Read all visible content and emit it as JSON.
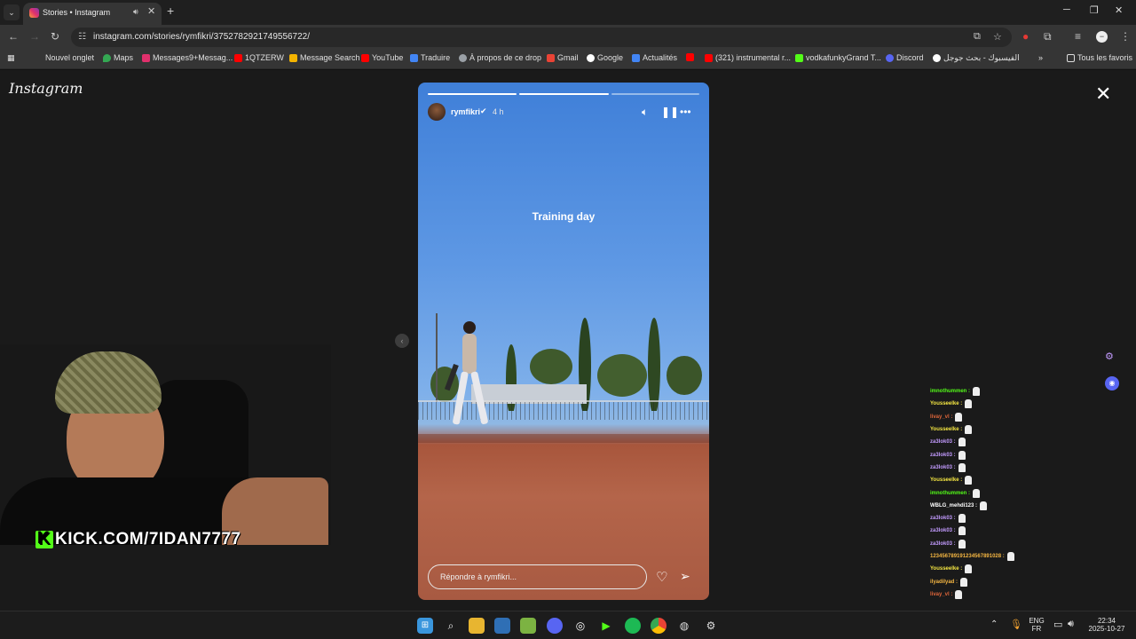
{
  "browser": {
    "tab_title": "Stories • Instagram",
    "url": "instagram.com/stories/rymfikri/3752782921749556722/",
    "bookmarks": [
      {
        "label": "Nouvel onglet",
        "color": "#9aa0a6"
      },
      {
        "label": "Maps",
        "color": "#34a853"
      },
      {
        "label": "Messages9+Messag...",
        "color": "#e1306c"
      },
      {
        "label": "1QTZERW",
        "color": "#ff0000"
      },
      {
        "label": "Message Search",
        "color": "#f4b400"
      },
      {
        "label": "YouTube",
        "color": "#ff0000"
      },
      {
        "label": "Traduire",
        "color": "#4285f4"
      },
      {
        "label": "À propos de ce drop",
        "color": "#9aa0a6"
      },
      {
        "label": "Gmail",
        "color": "#ea4335"
      },
      {
        "label": "Google",
        "color": "#9aa0a6"
      },
      {
        "label": "Actualités",
        "color": "#4285f4"
      },
      {
        "label": "",
        "color": "#ff0000"
      },
      {
        "label": "(321) instrumental r...",
        "color": "#ff0000"
      },
      {
        "label": "vodkafunkyGrand T...",
        "color": "#53fc18"
      },
      {
        "label": "Discord",
        "color": "#5865f2"
      },
      {
        "label": "الفيسبوك - بحث جوجل",
        "color": "#9aa0a6"
      }
    ],
    "bookmarks_all": "Tous les favoris"
  },
  "page": {
    "logo": "Instagram"
  },
  "story": {
    "username": "rymfikri",
    "time": "4 h",
    "caption": "Training day",
    "reply_placeholder": "Répondre à rymfikri...",
    "progress": [
      1,
      1,
      0.02
    ]
  },
  "stream": {
    "kick_url": "KICK.COM/7IDAN7777",
    "chat": [
      {
        "user": "imnothummen :",
        "color": "#53fc18"
      },
      {
        "user": "Yousseelke :",
        "color": "#f5e642"
      },
      {
        "user": "livay_vl :",
        "color": "#e0663a"
      },
      {
        "user": "Yousseelke :",
        "color": "#f5e642"
      },
      {
        "user": "za3lok03 :",
        "color": "#c39bff"
      },
      {
        "user": "za3lok03 :",
        "color": "#c39bff"
      },
      {
        "user": "za3lok03 :",
        "color": "#c39bff"
      },
      {
        "user": "Yousseelke :",
        "color": "#f5e642"
      },
      {
        "user": "imnothummen :",
        "color": "#53fc18"
      },
      {
        "user": "WBLG_mehdi123 :",
        "color": "#ffffff"
      },
      {
        "user": "za3lok03 :",
        "color": "#c39bff"
      },
      {
        "user": "za3lok03 :",
        "color": "#c39bff"
      },
      {
        "user": "za3lok03 :",
        "color": "#c39bff"
      },
      {
        "user": "123456789191234567891028 :",
        "color": "#f5b642"
      },
      {
        "user": "Yousseelke :",
        "color": "#f5e642"
      },
      {
        "user": "ilyadilyad :",
        "color": "#f5b642"
      },
      {
        "user": "livay_vl :",
        "color": "#e0663a"
      }
    ]
  },
  "taskbar": {
    "lang_top": "ENG",
    "lang_bottom": "FR",
    "time": "22:34",
    "date": "2025-10-27"
  }
}
